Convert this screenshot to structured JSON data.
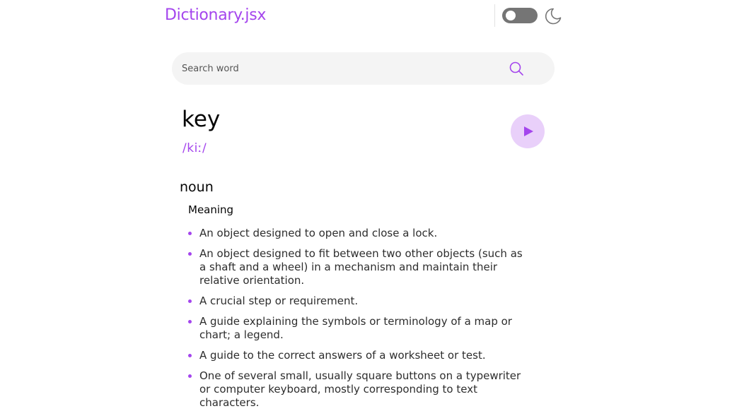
{
  "header": {
    "brand": "Dictionary.jsx",
    "theme_toggle": {
      "state": "off"
    },
    "moon_icon": "moon-icon"
  },
  "search": {
    "placeholder": "Search word",
    "value": "",
    "icon": "search-icon"
  },
  "entry": {
    "word": "key",
    "phonetic": "/kiː/",
    "play_icon": "play-icon",
    "part_of_speech": "noun",
    "meaning_heading": "Meaning",
    "definitions": [
      "An object designed to open and close a lock.",
      "An object designed to fit between two other objects (such as a shaft and a wheel) in a mechanism and maintain their relative orientation.",
      "A crucial step or requirement.",
      "A guide explaining the symbols or terminology of a map or chart; a legend.",
      "A guide to the correct answers of a worksheet or test.",
      "One of several small, usually square buttons on a typewriter or computer keyboard, mostly corresponding to text characters."
    ]
  },
  "colors": {
    "accent": "#a445ed",
    "play_bg": "#e9d0fa",
    "search_bg": "#f4f4f4",
    "toggle_bg": "#757575"
  }
}
